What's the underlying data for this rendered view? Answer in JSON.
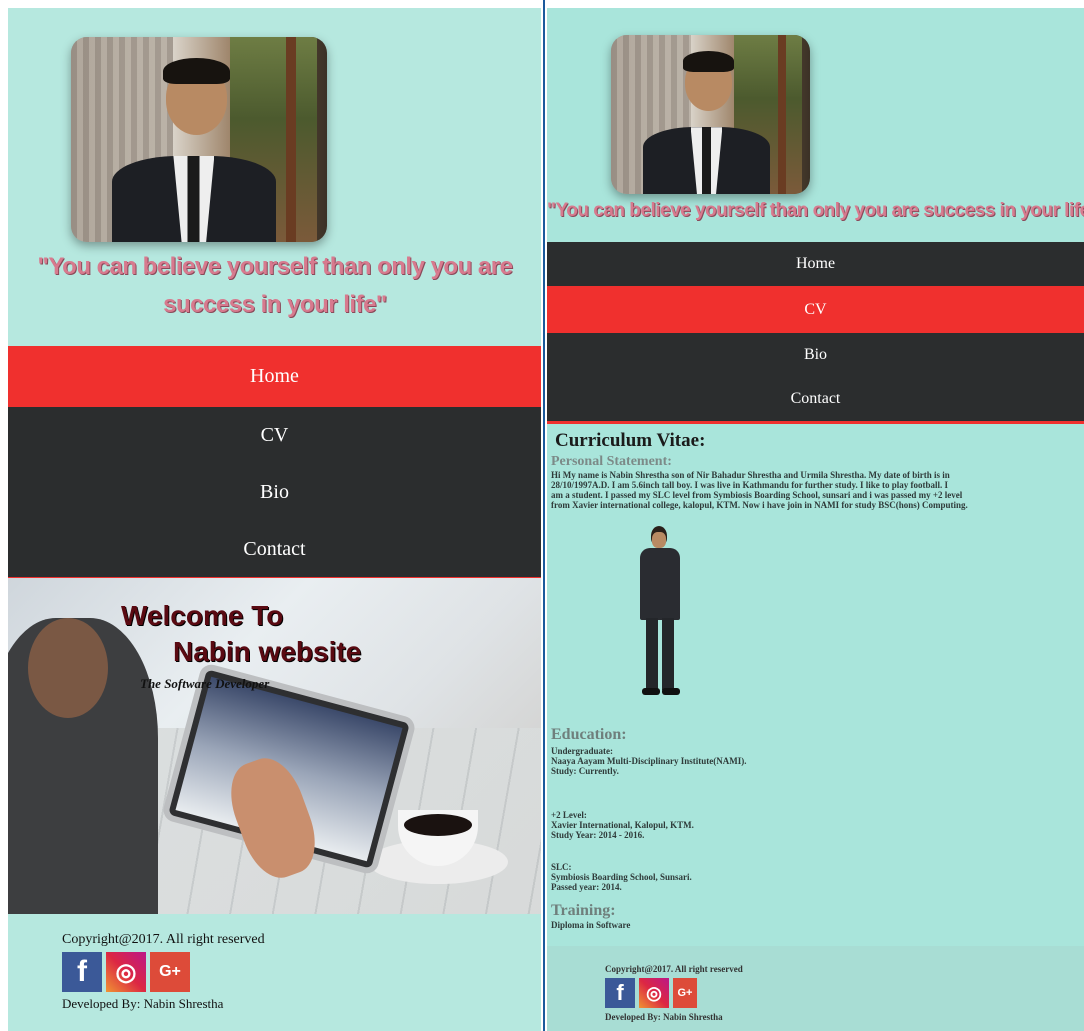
{
  "left": {
    "quote": "\"You can believe yourself than only you are success in your life\"",
    "nav": [
      {
        "label": "Home",
        "active": true
      },
      {
        "label": "CV",
        "active": false
      },
      {
        "label": "Bio",
        "active": false
      },
      {
        "label": "Contact",
        "active": false
      }
    ],
    "hero": {
      "line1": "Welcome To",
      "line2": "Nabin website",
      "tagline": "The Software Developer"
    },
    "footer": {
      "copyright": "Copyright@2017. All right reserved",
      "developed": "Developed By: Nabin Shrestha",
      "social": [
        "f",
        "◎",
        "G+"
      ]
    }
  },
  "right": {
    "quote": "\"You can believe yourself than only you are success in your life\"",
    "nav": [
      {
        "label": "Home",
        "active": false
      },
      {
        "label": "CV",
        "active": true
      },
      {
        "label": "Bio",
        "active": false
      },
      {
        "label": "Contact",
        "active": false
      }
    ],
    "cv": {
      "title": "Curriculum Vitae:",
      "personal_heading": "Personal Statement:",
      "personal_lines": [
        "Hi My name is Nabin Shrestha son of Nir Bahadur Shrestha and Urmila Shrestha. My date of birth is in",
        "28/10/1997A.D. I am 5.6inch tall boy. I was live in Kathmandu for further study. I like to play football. I",
        "am a student. I passed my SLC level from Symbiosis Boarding School, sunsari and i was passed my +2 level",
        "from Xavier international college, kalopul, KTM. Now i have join in NAMI for study BSC(hons) Computing."
      ],
      "education_heading": "Education:",
      "education": [
        {
          "lines": [
            "Undergraduate:",
            "Naaya Aayam Multi-Disciplinary Institute(NAMI).",
            "Study: Currently."
          ]
        },
        {
          "lines": [
            "+2 Level:",
            "Xavier International, Kalopul, KTM.",
            "Study Year: 2014 - 2016."
          ]
        },
        {
          "lines": [
            "SLC:",
            "Symbiosis Boarding School, Sunsari.",
            "Passed year: 2014."
          ]
        }
      ],
      "training_heading": "Training:",
      "training_text": "Diploma in Software"
    },
    "footer": {
      "copyright": "Copyright@2017. All right reserved",
      "developed": "Developed By: Nabin Shrestha",
      "social": [
        "f",
        "◎",
        "G+"
      ]
    }
  },
  "colors": {
    "background": "#b6e8df",
    "nav_dark": "#2b2d2e",
    "nav_active": "#f0302e",
    "quote": "#d77a8e"
  }
}
